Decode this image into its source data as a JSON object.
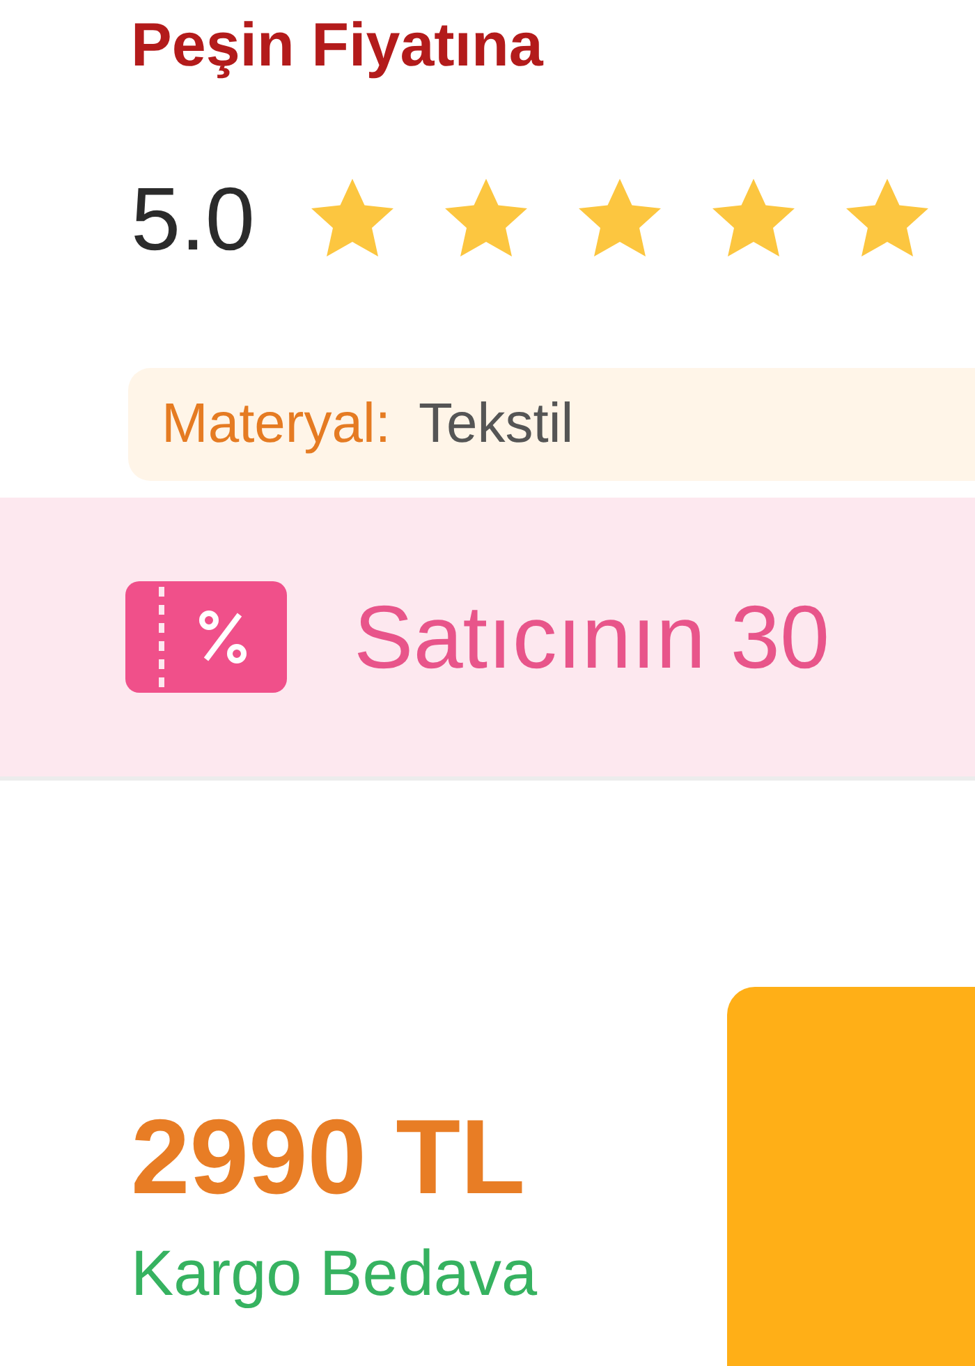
{
  "title": "Peşin Fiyatına",
  "rating": {
    "score": "5.0",
    "stars": 5
  },
  "attribute": {
    "label": "Materyal:",
    "value": "Tekstil"
  },
  "coupon_banner": {
    "text": "Satıcının 30"
  },
  "price": {
    "amount": "2990 TL",
    "shipping": "Kargo Bedava"
  }
}
